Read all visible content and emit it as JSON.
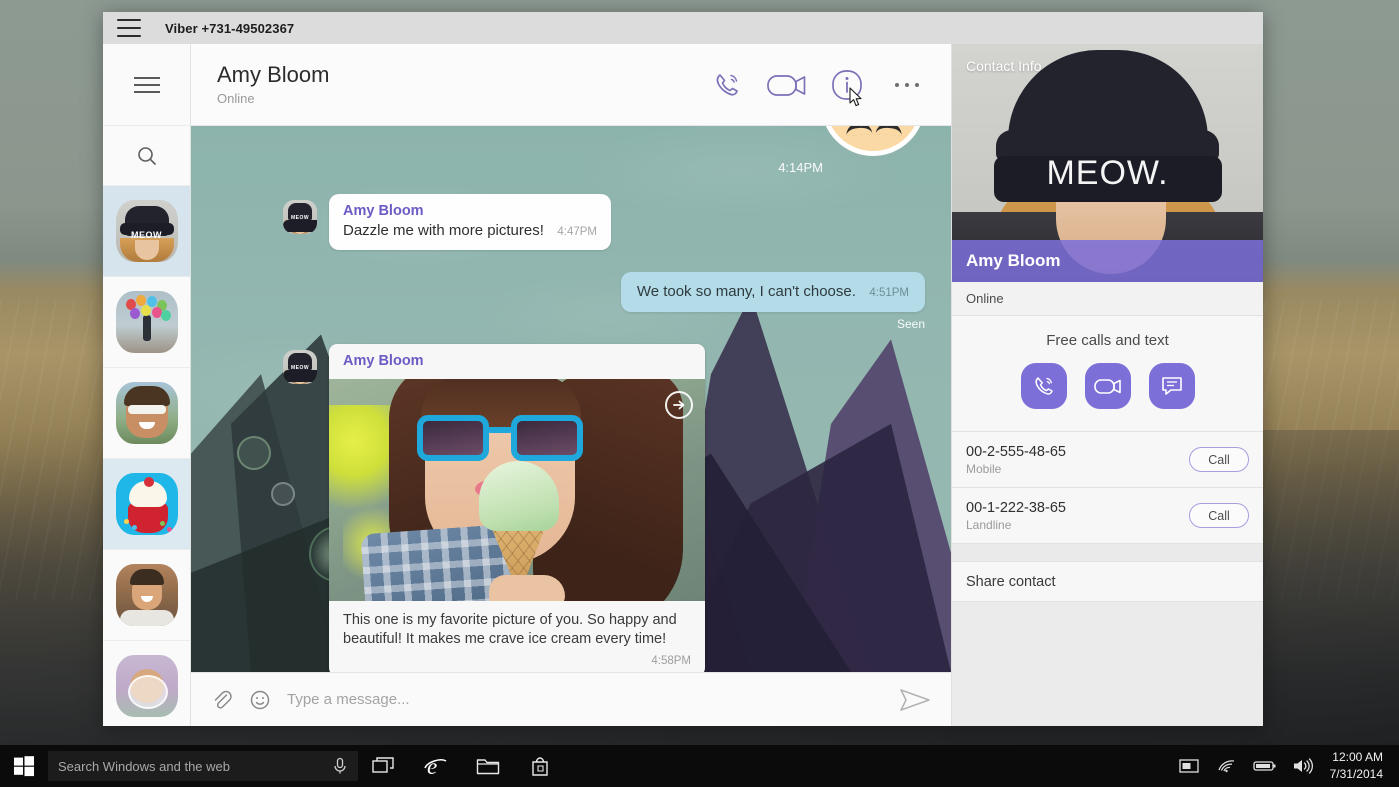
{
  "window": {
    "titlebar": {
      "menu_icon": "hamburger-icon",
      "title": "Viber +731-49502367"
    }
  },
  "rail": {
    "menu_icon": "hamburger-icon",
    "search_icon": "search-icon",
    "items": [
      {
        "name": "Amy Bloom",
        "avatar": "meow-beanie-photo",
        "selected": true
      },
      {
        "name": "Balloons contact",
        "avatar": "balloons-photo",
        "selected": false
      },
      {
        "name": "Sunglasses contact",
        "avatar": "sunglasses-man-photo",
        "selected": false
      },
      {
        "name": "Cupcake contact",
        "avatar": "cupcake-photo",
        "selected": true
      },
      {
        "name": "Smiling man contact",
        "avatar": "smiling-man-photo",
        "selected": false
      },
      {
        "name": "Bubble contact",
        "avatar": "bubble-photo",
        "selected": false
      }
    ]
  },
  "chat": {
    "header": {
      "name": "Amy Bloom",
      "status": "Online",
      "actions": [
        {
          "label": "Voice call",
          "icon": "phone-icon"
        },
        {
          "label": "Video call",
          "icon": "video-camera-icon"
        },
        {
          "label": "Contact info",
          "icon": "info-icon"
        },
        {
          "label": "More options",
          "icon": "ellipsis-icon"
        }
      ]
    },
    "messages": [
      {
        "type": "sticker",
        "direction": "out",
        "time": "4:14PM"
      },
      {
        "type": "text",
        "direction": "in",
        "sender": "Amy Bloom",
        "text": "Dazzle me with more pictures!",
        "time": "4:47PM"
      },
      {
        "type": "text",
        "direction": "out",
        "text": "We took so many, I can't choose.",
        "time": "4:51PM",
        "receipt": "Seen"
      },
      {
        "type": "photo",
        "direction": "in",
        "sender": "Amy Bloom",
        "caption": "This one is my favorite picture of you. So happy and beautiful! It makes me crave ice cream every time!",
        "time": "4:58PM",
        "forward_icon": "arrow-right-circle-icon"
      }
    ],
    "composer": {
      "attach_icon": "paperclip-icon",
      "emoji_icon": "smiley-icon",
      "placeholder": "Type a message...",
      "send_icon": "send-icon",
      "value": ""
    }
  },
  "info_panel": {
    "label": "Contact Info",
    "photo_text": "MEOW.",
    "name": "Amy Bloom",
    "status": "Online",
    "actions_title": "Free calls and text",
    "actions": [
      {
        "label": "Free call",
        "icon": "phone-icon"
      },
      {
        "label": "Free video call",
        "icon": "video-camera-icon"
      },
      {
        "label": "Free message",
        "icon": "chat-bubble-icon"
      }
    ],
    "phones": [
      {
        "number": "00-2-555-48-65",
        "type": "Mobile",
        "button": "Call"
      },
      {
        "number": "00-1-222-38-65",
        "type": "Landline",
        "button": "Call"
      }
    ],
    "share": "Share contact"
  },
  "taskbar": {
    "start_icon": "windows-logo-icon",
    "search_placeholder": "Search Windows and the web",
    "search_value": "",
    "mic_icon": "microphone-icon",
    "icons": [
      {
        "name": "task-view-icon"
      },
      {
        "name": "internet-explorer-icon"
      },
      {
        "name": "file-explorer-icon"
      },
      {
        "name": "store-icon"
      }
    ],
    "tray": [
      {
        "name": "action-center-icon"
      },
      {
        "name": "wifi-icon"
      },
      {
        "name": "battery-icon"
      },
      {
        "name": "volume-icon"
      }
    ],
    "time": "12:00 AM",
    "date": "7/31/2014"
  },
  "colors": {
    "viber_purple": "#7c6fd8",
    "sender_name": "#6b5bc4",
    "out_bubble": "#b3dbe8",
    "chat_bg": "#8fb4ae",
    "titlebar": "#dcdcdc"
  }
}
